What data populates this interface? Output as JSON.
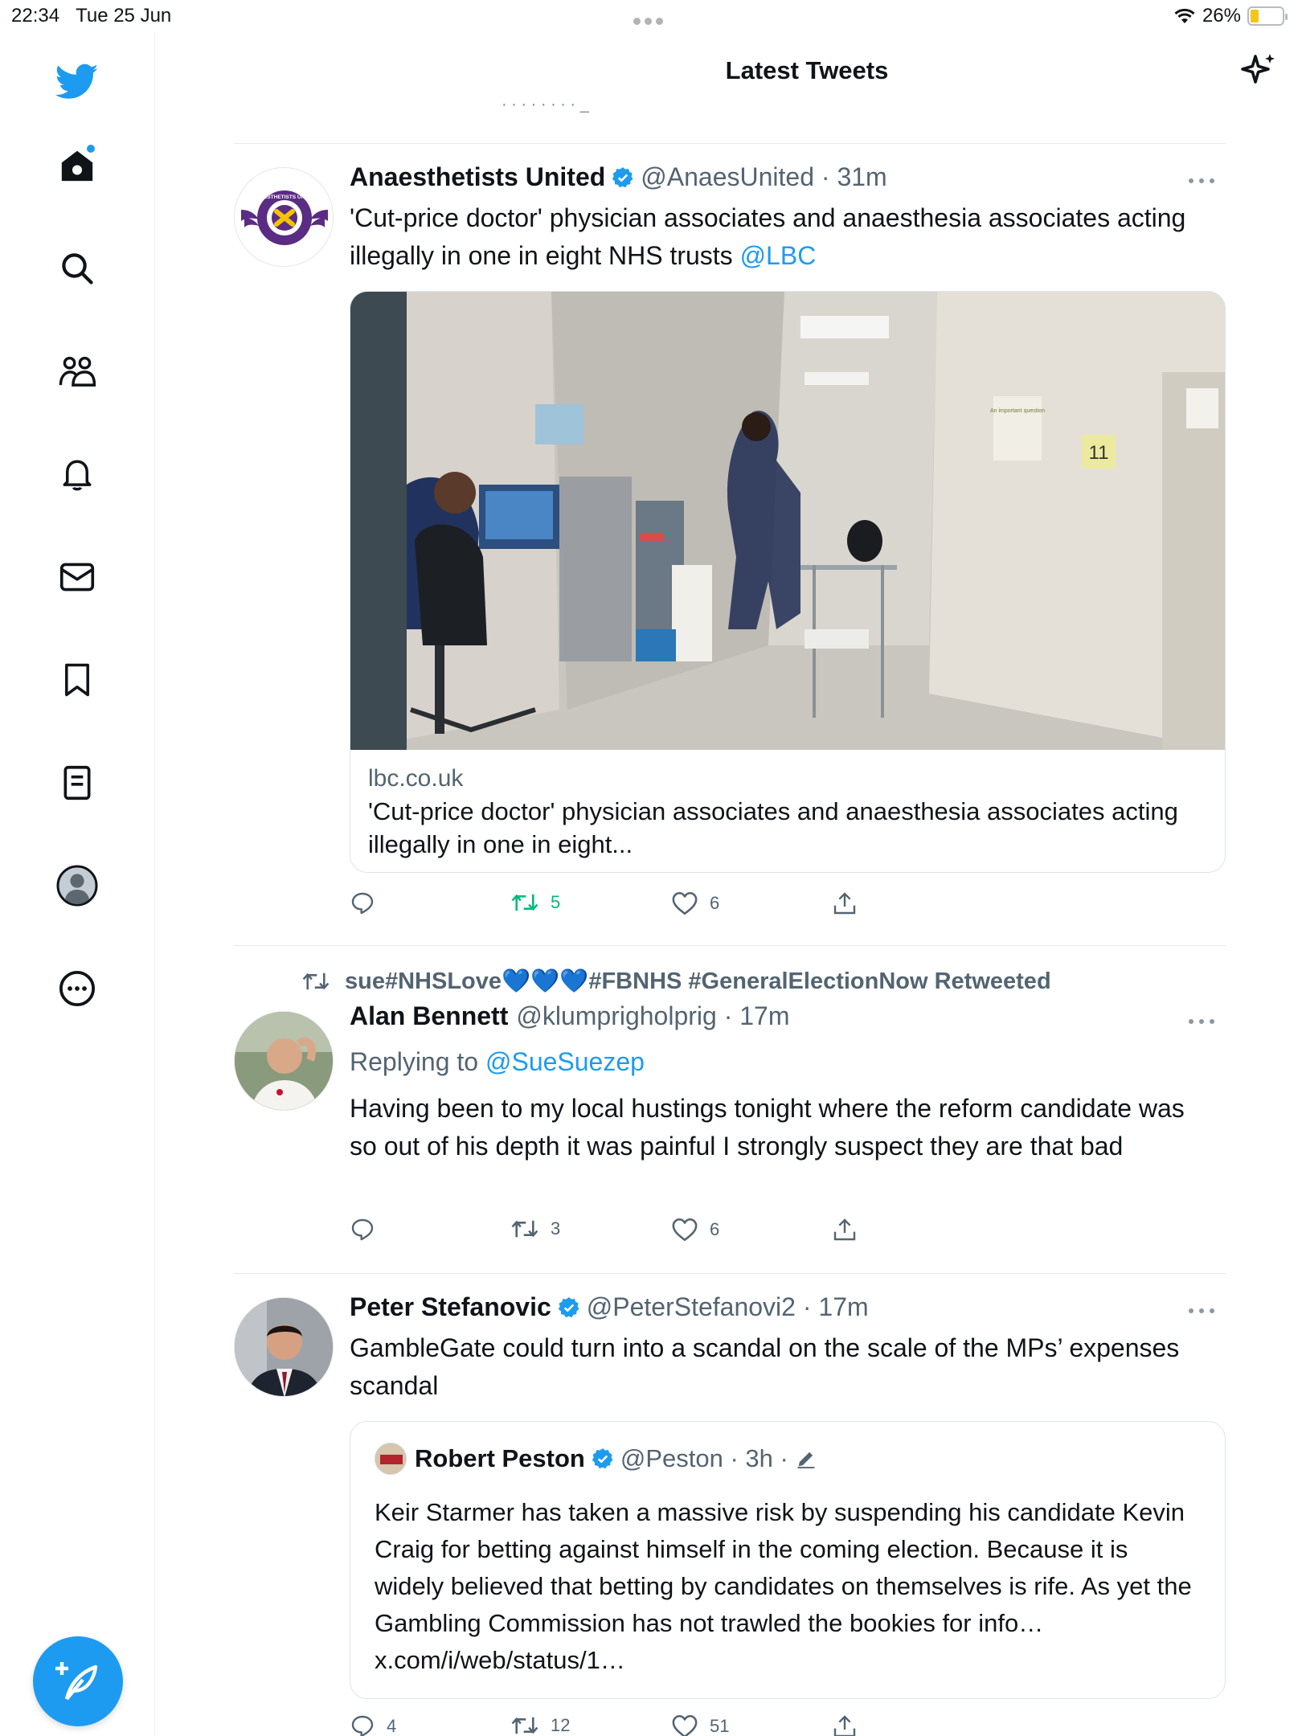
{
  "status_bar": {
    "time": "22:34",
    "date": "Tue 25 Jun",
    "battery": "26%",
    "battery_level": 0.26,
    "wifi_icon": "wifi-icon"
  },
  "header": {
    "title": "Latest Tweets",
    "sparkle_icon": "sparkle-icon",
    "peek_text": "· · · · · · · · _"
  },
  "sidebar": {
    "items": [
      {
        "name": "home",
        "icon": "home-icon"
      },
      {
        "name": "explore",
        "icon": "search-icon"
      },
      {
        "name": "communities",
        "icon": "communities-icon"
      },
      {
        "name": "notifications",
        "icon": "bell-icon"
      },
      {
        "name": "messages",
        "icon": "mail-icon"
      },
      {
        "name": "bookmarks",
        "icon": "bookmark-icon"
      },
      {
        "name": "lists",
        "icon": "list-icon"
      },
      {
        "name": "profile",
        "icon": "profile-icon"
      },
      {
        "name": "more",
        "icon": "more-circle-icon"
      }
    ],
    "compose_icon": "feather-plus-icon"
  },
  "tweets": [
    {
      "name": "Anaesthetists United",
      "verified": true,
      "handle": "@AnaesUnited",
      "time": "31m",
      "text": "'Cut-price doctor' physician associates and anaesthesia associates acting illegally in one in eight NHS trusts ",
      "mention": "@LBC",
      "avatar_text": "ANAESTHETISTS UNITED",
      "card": {
        "domain": "lbc.co.uk",
        "title": "'Cut-price doctor' physician associates and anaesthesia associates acting illegally in one in eight...",
        "image_sign_number": "11",
        "image_sign_text": "An important question"
      },
      "replies": "",
      "retweets": "5",
      "likes": "6"
    },
    {
      "retweeted_by": "sue#NHSLove💙💙💙#FBNHS #GeneralElectionNow Retweeted",
      "name": "Alan Bennett",
      "verified": false,
      "handle": "@klumprigholprig",
      "time": "17m",
      "replying_to_label": "Replying to ",
      "replying_to": "@SueSuezep",
      "text": "Having been to my local hustings tonight where the reform candidate was so out of his depth it was painful I strongly suspect they are that bad",
      "replies": "",
      "retweets": "3",
      "likes": "6"
    },
    {
      "name": "Peter Stefanovic",
      "verified": true,
      "handle": "@PeterStefanovi2",
      "time": "17m",
      "text": "GambleGate could turn into a scandal on the scale of the MPs’ expenses scandal",
      "quote": {
        "name": "Robert Peston",
        "verified": true,
        "handle": "@Peston",
        "time": "3h",
        "text": "Keir Starmer has taken a massive risk by suspending his candidate Kevin Craig for betting against himself in the coming election. Because it is widely believed that betting by candidates on themselves is rife.  As yet the Gambling Commission has not trawled the bookies for info… x.com/i/web/status/1…"
      },
      "replies": "4",
      "retweets": "12",
      "likes": "51"
    }
  ],
  "colors": {
    "accent": "#1d9bf0",
    "retweet_green": "#00ba7c",
    "muted": "#536471",
    "text": "#0f1419"
  }
}
